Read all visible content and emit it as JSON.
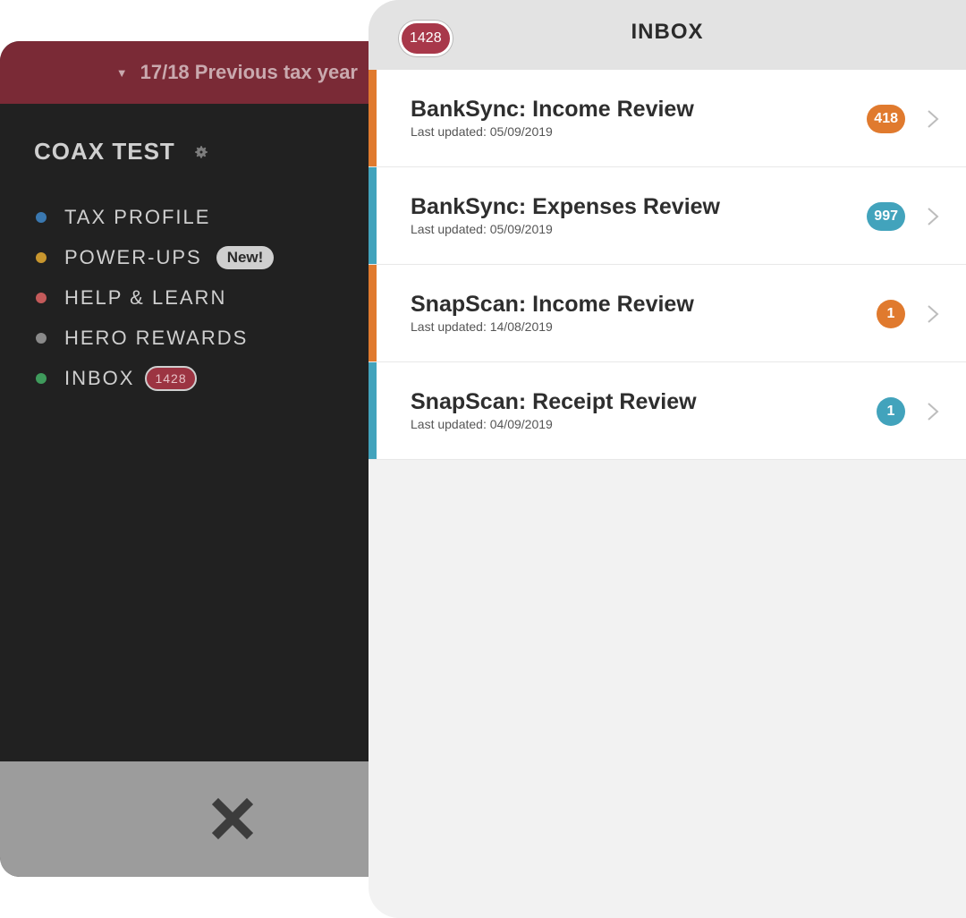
{
  "sidebar": {
    "year_selector": "17/18 Previous tax year",
    "account_name": "COAX TEST",
    "nav": [
      {
        "label": "TAX PROFILE",
        "dot_color": "#3a78b0"
      },
      {
        "label": "POWER-UPS",
        "dot_color": "#c8962e",
        "badge": "New!"
      },
      {
        "label": "HELP & LEARN",
        "dot_color": "#c45a5a"
      },
      {
        "label": "HERO REWARDS",
        "dot_color": "#8a8a8a"
      },
      {
        "label": "INBOX",
        "dot_color": "#3f9b5c",
        "badge": "1428"
      }
    ],
    "colors": {
      "year_bar": "#7a2a36",
      "panel": "#212121",
      "close_bar": "#9c9c9c"
    }
  },
  "inbox": {
    "title": "INBOX",
    "count": "1428",
    "items": [
      {
        "title": "BankSync: Income Review",
        "subtitle": "Last updated: 05/09/2019",
        "count": "418",
        "accent": "#e07a2e"
      },
      {
        "title": "BankSync: Expenses Review",
        "subtitle": "Last updated: 05/09/2019",
        "count": "997",
        "accent": "#42a3bc"
      },
      {
        "title": "SnapScan: Income Review",
        "subtitle": "Last updated: 14/08/2019",
        "count": "1",
        "accent": "#e07a2e"
      },
      {
        "title": "SnapScan: Receipt Review",
        "subtitle": "Last updated: 04/09/2019",
        "count": "1",
        "accent": "#42a3bc"
      }
    ]
  },
  "icons": {
    "year_caret": "caret-down-icon",
    "settings": "gear-icon",
    "close": "close-icon",
    "row_arrow": "chevron-right-icon"
  }
}
